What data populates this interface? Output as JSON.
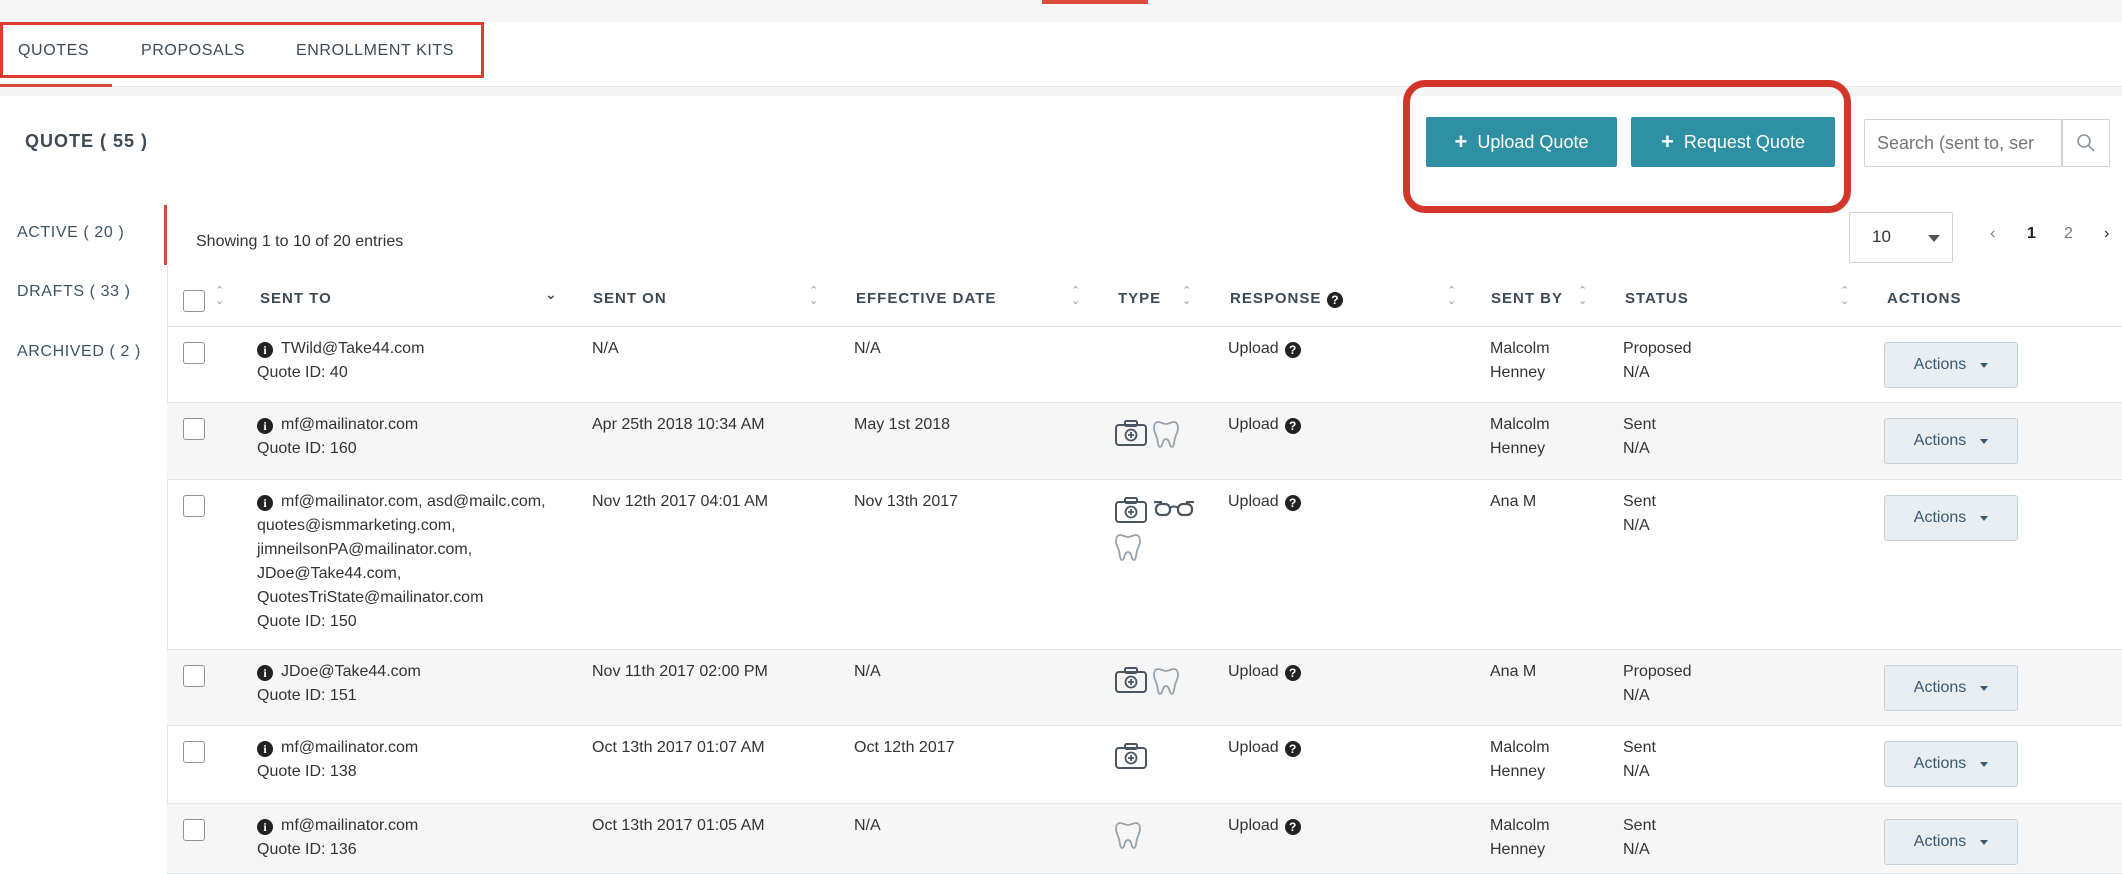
{
  "tabs": [
    {
      "label": "QUOTES"
    },
    {
      "label": "PROPOSALS"
    },
    {
      "label": "ENROLLMENT KITS"
    }
  ],
  "header": {
    "title": "QUOTE ( 55 )",
    "upload_label": "Upload Quote",
    "request_label": "Request Quote",
    "search_placeholder": "Search (sent to, ser"
  },
  "leftnav": [
    {
      "label": "ACTIVE ( 20 )"
    },
    {
      "label": "DRAFTS ( 33 )"
    },
    {
      "label": "ARCHIVED ( 2 )"
    }
  ],
  "entries_text": "Showing 1 to 10 of 20 entries",
  "page_size": "10",
  "pages": [
    "1",
    "2"
  ],
  "columns": [
    "SENT TO",
    "SENT ON",
    "EFFECTIVE DATE",
    "TYPE",
    "RESPONSE",
    "SENT BY",
    "STATUS",
    "ACTIONS"
  ],
  "rows": [
    {
      "sent_to": "TWild@Take44.com",
      "quote_id": "Quote ID: 40",
      "sent_on": "N/A",
      "effective": "N/A",
      "types": [],
      "response": "Upload",
      "sent_by_1": "Malcolm",
      "sent_by_2": "Henney",
      "status": "Proposed",
      "status_sub": "N/A",
      "actions": "Actions"
    },
    {
      "sent_to": "mf@mailinator.com",
      "quote_id": "Quote ID: 160",
      "sent_on": "Apr 25th 2018 10:34 AM",
      "effective": "May 1st 2018",
      "types": [
        "medical-icon",
        "dental-icon"
      ],
      "response": "Upload",
      "sent_by_1": "Malcolm",
      "sent_by_2": "Henney",
      "status": "Sent",
      "status_sub": "N/A",
      "actions": "Actions"
    },
    {
      "sent_to_lines": [
        "mf@mailinator.com, asd@mailc.com,",
        "quotes@ismmarketing.com,",
        "jimneilsonPA@mailinator.com,",
        "JDoe@Take44.com,",
        "QuotesTriState@mailinator.com"
      ],
      "quote_id": "Quote ID: 150",
      "sent_on": "Nov 12th 2017 04:01 AM",
      "effective": "Nov 13th 2017",
      "types": [
        "medical-icon",
        "vision-icon",
        "dental-icon"
      ],
      "response": "Upload",
      "sent_by_1": "Ana M",
      "sent_by_2": "",
      "status": "Sent",
      "status_sub": "N/A",
      "actions": "Actions"
    },
    {
      "sent_to": "JDoe@Take44.com",
      "quote_id": "Quote ID: 151",
      "sent_on": "Nov 11th 2017 02:00 PM",
      "effective": "N/A",
      "types": [
        "medical-icon",
        "dental-icon"
      ],
      "response": "Upload",
      "sent_by_1": "Ana M",
      "sent_by_2": "",
      "status": "Proposed",
      "status_sub": "N/A",
      "actions": "Actions"
    },
    {
      "sent_to": "mf@mailinator.com",
      "quote_id": "Quote ID: 138",
      "sent_on": "Oct 13th 2017 01:07 AM",
      "effective": "Oct 12th 2017",
      "types": [
        "medical-icon"
      ],
      "response": "Upload",
      "sent_by_1": "Malcolm",
      "sent_by_2": "Henney",
      "status": "Sent",
      "status_sub": "N/A",
      "actions": "Actions"
    },
    {
      "sent_to": "mf@mailinator.com",
      "quote_id": "Quote ID: 136",
      "sent_on": "Oct 13th 2017 01:05 AM",
      "effective": "N/A",
      "types": [
        "dental-icon"
      ],
      "response": "Upload",
      "sent_by_1": "Malcolm",
      "sent_by_2": "Henney",
      "status": "Sent",
      "status_sub": "N/A",
      "actions": "Actions"
    }
  ],
  "colors": {
    "primary": "#2f8fa3",
    "highlight": "#d3362b",
    "accent": "#d64b3d"
  }
}
